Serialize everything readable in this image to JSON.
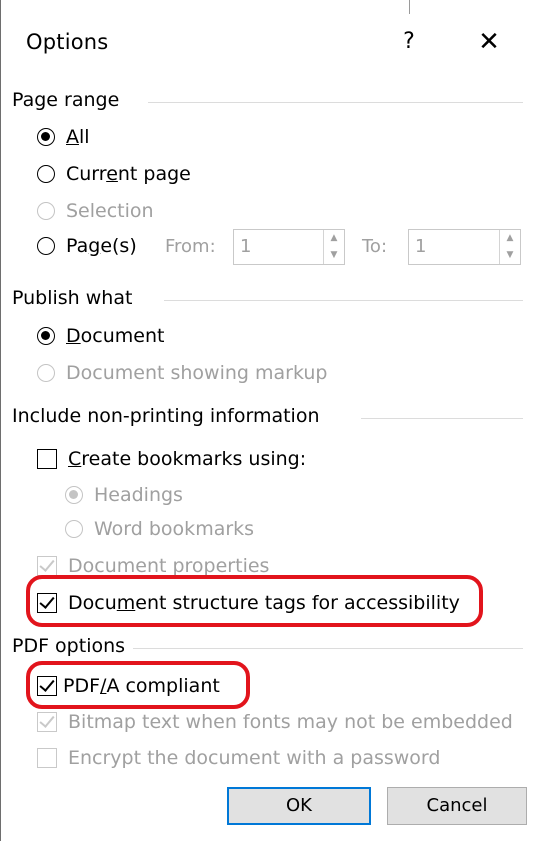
{
  "dialog": {
    "title": "Options",
    "help_label": "?",
    "close_label": "✕"
  },
  "page_range": {
    "header": "Page range",
    "all": {
      "pre": "",
      "ul": "A",
      "post": "ll"
    },
    "current_page": {
      "pre": "Curr",
      "ul": "e",
      "post": "nt page"
    },
    "selection": "Selection",
    "pages": {
      "pre": "Pa",
      "ul": "g",
      "post": "e(s)"
    },
    "from_label": "From:",
    "from_value": "1",
    "to_label": "To:",
    "to_value": "1"
  },
  "publish_what": {
    "header": "Publish what",
    "document": {
      "pre": "",
      "ul": "D",
      "post": "ocument"
    },
    "document_markup": "Document showing markup"
  },
  "non_printing": {
    "header": "Include non-printing information",
    "create_bookmarks": {
      "pre": "",
      "ul": "C",
      "post": "reate bookmarks using:"
    },
    "headings": "Headings",
    "word_bookmarks": "Word bookmarks",
    "doc_properties": "Document properties",
    "structure_tags": {
      "pre": "Docu",
      "ul": "m",
      "post": "ent structure tags for accessibility"
    }
  },
  "pdf_options": {
    "header": "PDF options",
    "pdfa": {
      "pre": "PDF",
      "ul": "/",
      "post": "A compliant"
    },
    "bitmap_text": "Bitmap text when fonts may not be embedded",
    "encrypt": "Encrypt the document with a password"
  },
  "buttons": {
    "ok": "OK",
    "cancel": "Cancel"
  },
  "colors": {
    "highlight_red": "#e2141c",
    "default_button_border": "#0078d7"
  }
}
